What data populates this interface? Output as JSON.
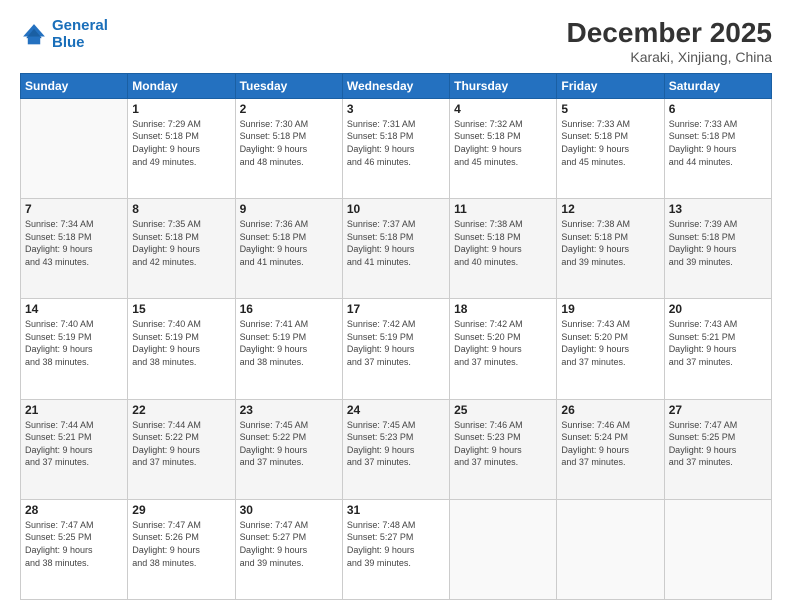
{
  "header": {
    "logo_line1": "General",
    "logo_line2": "Blue",
    "month": "December 2025",
    "location": "Karaki, Xinjiang, China"
  },
  "weekdays": [
    "Sunday",
    "Monday",
    "Tuesday",
    "Wednesday",
    "Thursday",
    "Friday",
    "Saturday"
  ],
  "weeks": [
    [
      {
        "day": "",
        "info": ""
      },
      {
        "day": "1",
        "info": "Sunrise: 7:29 AM\nSunset: 5:18 PM\nDaylight: 9 hours\nand 49 minutes."
      },
      {
        "day": "2",
        "info": "Sunrise: 7:30 AM\nSunset: 5:18 PM\nDaylight: 9 hours\nand 48 minutes."
      },
      {
        "day": "3",
        "info": "Sunrise: 7:31 AM\nSunset: 5:18 PM\nDaylight: 9 hours\nand 46 minutes."
      },
      {
        "day": "4",
        "info": "Sunrise: 7:32 AM\nSunset: 5:18 PM\nDaylight: 9 hours\nand 45 minutes."
      },
      {
        "day": "5",
        "info": "Sunrise: 7:33 AM\nSunset: 5:18 PM\nDaylight: 9 hours\nand 45 minutes."
      },
      {
        "day": "6",
        "info": "Sunrise: 7:33 AM\nSunset: 5:18 PM\nDaylight: 9 hours\nand 44 minutes."
      }
    ],
    [
      {
        "day": "7",
        "info": "Sunrise: 7:34 AM\nSunset: 5:18 PM\nDaylight: 9 hours\nand 43 minutes."
      },
      {
        "day": "8",
        "info": "Sunrise: 7:35 AM\nSunset: 5:18 PM\nDaylight: 9 hours\nand 42 minutes."
      },
      {
        "day": "9",
        "info": "Sunrise: 7:36 AM\nSunset: 5:18 PM\nDaylight: 9 hours\nand 41 minutes."
      },
      {
        "day": "10",
        "info": "Sunrise: 7:37 AM\nSunset: 5:18 PM\nDaylight: 9 hours\nand 41 minutes."
      },
      {
        "day": "11",
        "info": "Sunrise: 7:38 AM\nSunset: 5:18 PM\nDaylight: 9 hours\nand 40 minutes."
      },
      {
        "day": "12",
        "info": "Sunrise: 7:38 AM\nSunset: 5:18 PM\nDaylight: 9 hours\nand 39 minutes."
      },
      {
        "day": "13",
        "info": "Sunrise: 7:39 AM\nSunset: 5:18 PM\nDaylight: 9 hours\nand 39 minutes."
      }
    ],
    [
      {
        "day": "14",
        "info": "Sunrise: 7:40 AM\nSunset: 5:19 PM\nDaylight: 9 hours\nand 38 minutes."
      },
      {
        "day": "15",
        "info": "Sunrise: 7:40 AM\nSunset: 5:19 PM\nDaylight: 9 hours\nand 38 minutes."
      },
      {
        "day": "16",
        "info": "Sunrise: 7:41 AM\nSunset: 5:19 PM\nDaylight: 9 hours\nand 38 minutes."
      },
      {
        "day": "17",
        "info": "Sunrise: 7:42 AM\nSunset: 5:19 PM\nDaylight: 9 hours\nand 37 minutes."
      },
      {
        "day": "18",
        "info": "Sunrise: 7:42 AM\nSunset: 5:20 PM\nDaylight: 9 hours\nand 37 minutes."
      },
      {
        "day": "19",
        "info": "Sunrise: 7:43 AM\nSunset: 5:20 PM\nDaylight: 9 hours\nand 37 minutes."
      },
      {
        "day": "20",
        "info": "Sunrise: 7:43 AM\nSunset: 5:21 PM\nDaylight: 9 hours\nand 37 minutes."
      }
    ],
    [
      {
        "day": "21",
        "info": "Sunrise: 7:44 AM\nSunset: 5:21 PM\nDaylight: 9 hours\nand 37 minutes."
      },
      {
        "day": "22",
        "info": "Sunrise: 7:44 AM\nSunset: 5:22 PM\nDaylight: 9 hours\nand 37 minutes."
      },
      {
        "day": "23",
        "info": "Sunrise: 7:45 AM\nSunset: 5:22 PM\nDaylight: 9 hours\nand 37 minutes."
      },
      {
        "day": "24",
        "info": "Sunrise: 7:45 AM\nSunset: 5:23 PM\nDaylight: 9 hours\nand 37 minutes."
      },
      {
        "day": "25",
        "info": "Sunrise: 7:46 AM\nSunset: 5:23 PM\nDaylight: 9 hours\nand 37 minutes."
      },
      {
        "day": "26",
        "info": "Sunrise: 7:46 AM\nSunset: 5:24 PM\nDaylight: 9 hours\nand 37 minutes."
      },
      {
        "day": "27",
        "info": "Sunrise: 7:47 AM\nSunset: 5:25 PM\nDaylight: 9 hours\nand 37 minutes."
      }
    ],
    [
      {
        "day": "28",
        "info": "Sunrise: 7:47 AM\nSunset: 5:25 PM\nDaylight: 9 hours\nand 38 minutes."
      },
      {
        "day": "29",
        "info": "Sunrise: 7:47 AM\nSunset: 5:26 PM\nDaylight: 9 hours\nand 38 minutes."
      },
      {
        "day": "30",
        "info": "Sunrise: 7:47 AM\nSunset: 5:27 PM\nDaylight: 9 hours\nand 39 minutes."
      },
      {
        "day": "31",
        "info": "Sunrise: 7:48 AM\nSunset: 5:27 PM\nDaylight: 9 hours\nand 39 minutes."
      },
      {
        "day": "",
        "info": ""
      },
      {
        "day": "",
        "info": ""
      },
      {
        "day": "",
        "info": ""
      }
    ]
  ]
}
